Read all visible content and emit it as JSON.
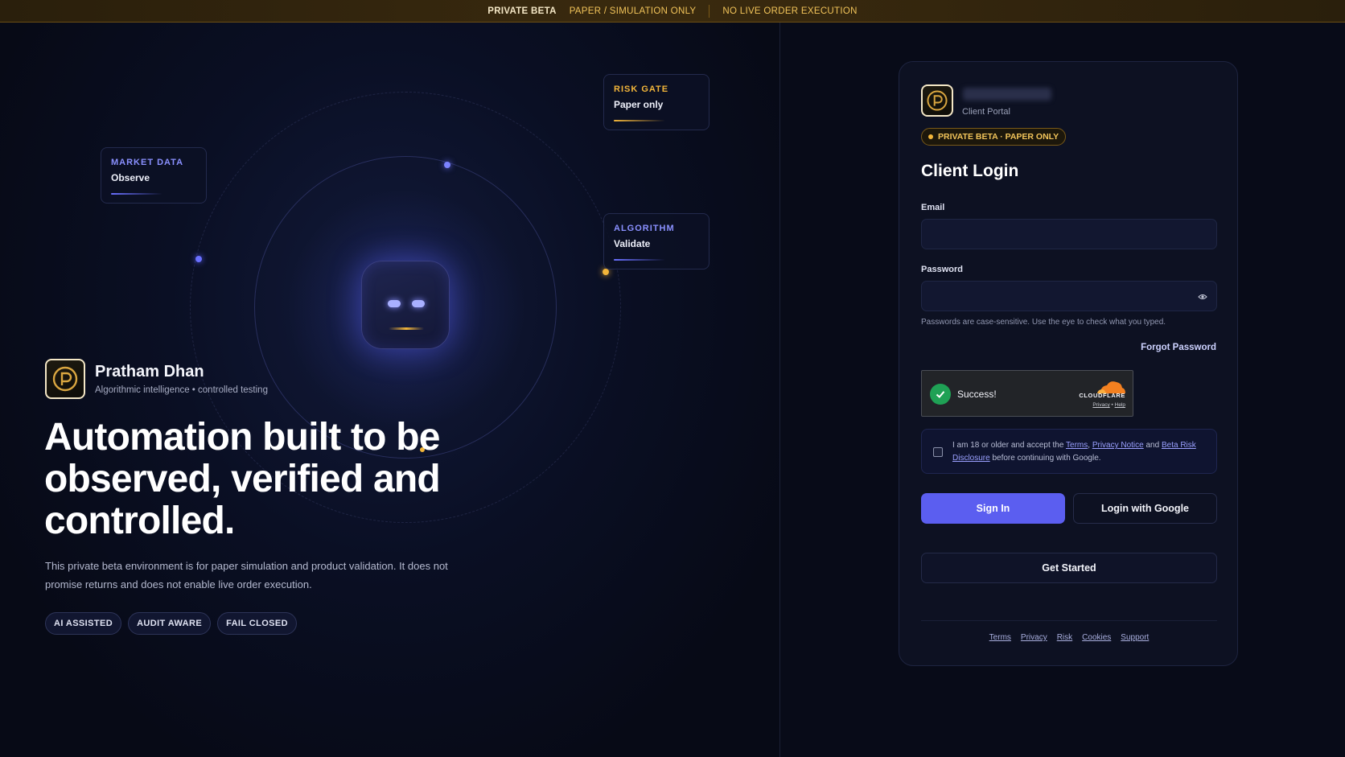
{
  "banner": {
    "primary": "PRIVATE BETA",
    "secondary": "PAPER / SIMULATION ONLY",
    "tertiary": "NO LIVE ORDER EXECUTION"
  },
  "hero": {
    "cards": {
      "market": {
        "title": "MARKET DATA",
        "subtitle": "Observe"
      },
      "risk": {
        "title": "RISK GATE",
        "subtitle": "Paper only"
      },
      "algorithm": {
        "title": "ALGORITHM",
        "subtitle": "Validate"
      }
    },
    "brand_name": "Pratham Dhan",
    "brand_tagline": "Algorithmic intelligence • controlled testing",
    "headline": "Automation built to be observed, verified and controlled.",
    "description": "This private beta environment is for paper simulation and product validation. It does not promise returns and does not enable live order execution.",
    "pills": [
      "AI ASSISTED",
      "AUDIT AWARE",
      "FAIL CLOSED"
    ]
  },
  "login": {
    "portal_label": "Client Portal",
    "badge": "PRIVATE BETA · PAPER ONLY",
    "title": "Client Login",
    "email_label": "Email",
    "email_value": "",
    "password_label": "Password",
    "password_value": "",
    "password_hint": "Passwords are case-sensitive. Use the eye to check what you typed.",
    "forgot": "Forgot Password",
    "captcha": {
      "status": "Success!",
      "provider": "CLOUDFLARE",
      "privacy": "Privacy",
      "help": "Help"
    },
    "consent": {
      "prefix": "I am 18 or older and accept the ",
      "terms": "Terms",
      "comma": ", ",
      "privacy": "Privacy Notice",
      "and": " and ",
      "risk": "Beta Risk Disclosure",
      "suffix": " before continuing with Google."
    },
    "signin": "Sign In",
    "google": "Login with Google",
    "get_started": "Get Started",
    "footer_links": [
      "Terms",
      "Privacy",
      "Risk",
      "Cookies",
      "Support"
    ]
  },
  "colors": {
    "accent": "#5b5ef0",
    "gold": "#f2b53a",
    "background": "#070a16"
  }
}
